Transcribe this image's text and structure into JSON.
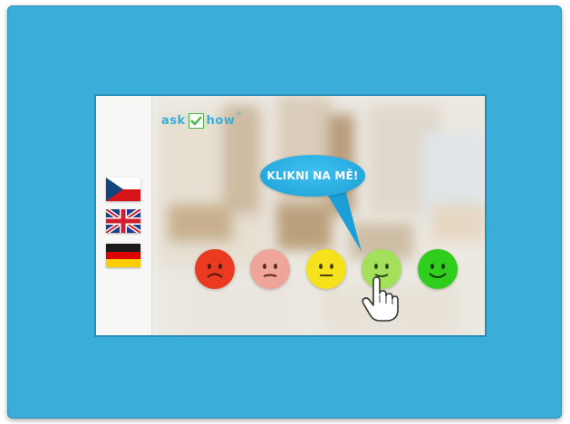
{
  "brand": {
    "logo_left": "ask",
    "logo_right": "how",
    "accent_color": "#3aaed8",
    "check_color": "#46b640"
  },
  "callout": {
    "text": "KLIKNI NA MĚ!",
    "color": "#2bb0e8"
  },
  "languages": [
    {
      "code": "cs",
      "icon": "czech-flag-icon"
    },
    {
      "code": "en",
      "icon": "uk-flag-icon"
    },
    {
      "code": "de",
      "icon": "german-flag-icon"
    }
  ],
  "rating_faces": [
    {
      "mood": "very-unhappy",
      "color": "#ea3a22",
      "icon": "very-unhappy-face-icon"
    },
    {
      "mood": "unhappy",
      "color": "#f0a59b",
      "icon": "unhappy-face-icon"
    },
    {
      "mood": "neutral",
      "color": "#f5e21c",
      "icon": "neutral-face-icon"
    },
    {
      "mood": "happy",
      "color": "#a5e05c",
      "icon": "happy-face-icon"
    },
    {
      "mood": "very-happy",
      "color": "#2fce1c",
      "icon": "very-happy-face-icon"
    }
  ],
  "pointer": {
    "icon": "hand-pointer-icon",
    "target": "happy"
  }
}
